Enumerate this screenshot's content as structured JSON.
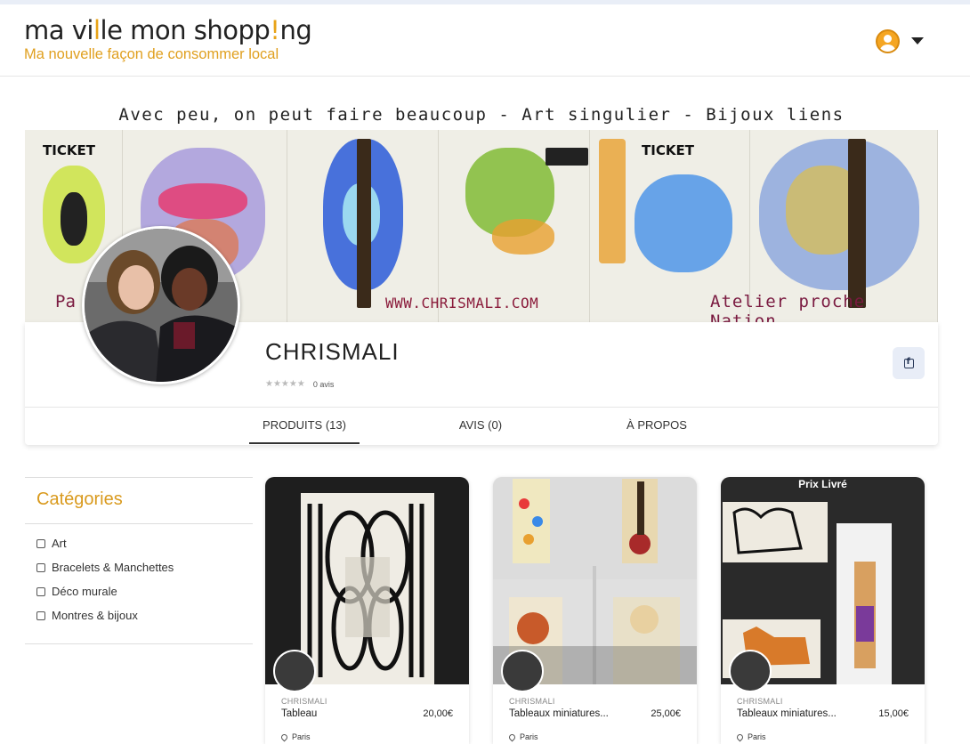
{
  "header": {
    "logo_part1": "ma vi",
    "logo_accent1": "l",
    "logo_part2": "le mon shopp",
    "logo_accent2": "!",
    "logo_part3": "ng",
    "tagline": "Ma nouvelle façon de consommer local",
    "user_icon": "user-avatar-icon",
    "menu_icon": "caret-down-icon"
  },
  "banner": {
    "title": "Avec peu, on peut faire beaucoup - Art singulier - Bijoux liens",
    "left_text": "Pa",
    "url": "WWW.CHRISMALI.COM",
    "right_text": "Atelier proche Nation",
    "ticket_label": "TICKET"
  },
  "shop": {
    "name": "CHRISMALI",
    "stars": "★★★★★",
    "reviews": "0 avis",
    "facebook_icon": "facebook-icon"
  },
  "tabs": [
    {
      "label": "PRODUITS (13)",
      "active": true
    },
    {
      "label": "AVIS (0)",
      "active": false
    },
    {
      "label": "À PROPOS",
      "active": false
    }
  ],
  "sidebar": {
    "title": "Catégories",
    "categories": [
      "Art",
      "Bracelets & Manchettes",
      "Déco murale",
      "Montres & bijoux"
    ]
  },
  "products": [
    {
      "seller": "CHRISMALI",
      "name": "Tableau",
      "price": "20,00€",
      "location": "Paris",
      "badge": ""
    },
    {
      "seller": "CHRISMALI",
      "name": "Tableaux miniatures...",
      "price": "25,00€",
      "location": "Paris",
      "badge": ""
    },
    {
      "seller": "CHRISMALI",
      "name": "Tableaux miniatures...",
      "price": "15,00€",
      "location": "Paris",
      "badge": "Prix Livré"
    }
  ],
  "colors": {
    "accent": "#e0a020",
    "text": "#222222",
    "facebook_bg": "#e8edf7"
  }
}
